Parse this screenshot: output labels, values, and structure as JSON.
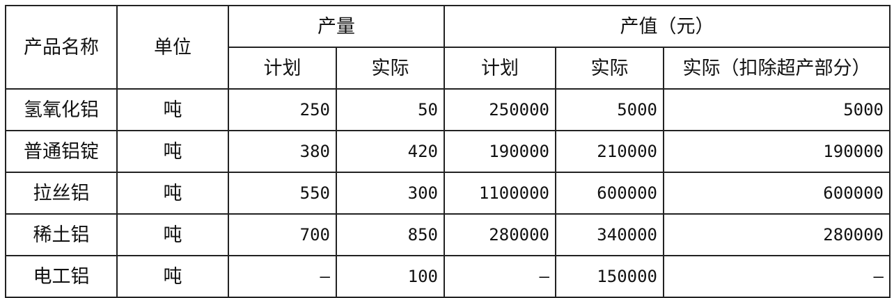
{
  "header": {
    "product_name": "产品名称",
    "unit": "单位",
    "quantity_group": "产量",
    "value_group": "产值（元）",
    "quantity_plan": "计划",
    "quantity_actual": "实际",
    "value_plan": "计划",
    "value_actual": "实际",
    "value_actual_excl": "实际（扣除超产部分）"
  },
  "rows": [
    {
      "name": "氢氧化铝",
      "unit": "吨",
      "qty_plan": "250",
      "qty_actual": "50",
      "val_plan": "250000",
      "val_actual": "5000",
      "val_actual_excl": "5000"
    },
    {
      "name": "普通铝锭",
      "unit": "吨",
      "qty_plan": "380",
      "qty_actual": "420",
      "val_plan": "190000",
      "val_actual": "210000",
      "val_actual_excl": "190000"
    },
    {
      "name": "拉丝铝",
      "unit": "吨",
      "qty_plan": "550",
      "qty_actual": "300",
      "val_plan": "1100000",
      "val_actual": "600000",
      "val_actual_excl": "600000"
    },
    {
      "name": "稀土铝",
      "unit": "吨",
      "qty_plan": "700",
      "qty_actual": "850",
      "val_plan": "280000",
      "val_actual": "340000",
      "val_actual_excl": "280000"
    },
    {
      "name": "电工铝",
      "unit": "吨",
      "qty_plan": "—",
      "qty_actual": "100",
      "val_plan": "—",
      "val_actual": "150000",
      "val_actual_excl": "—"
    }
  ]
}
